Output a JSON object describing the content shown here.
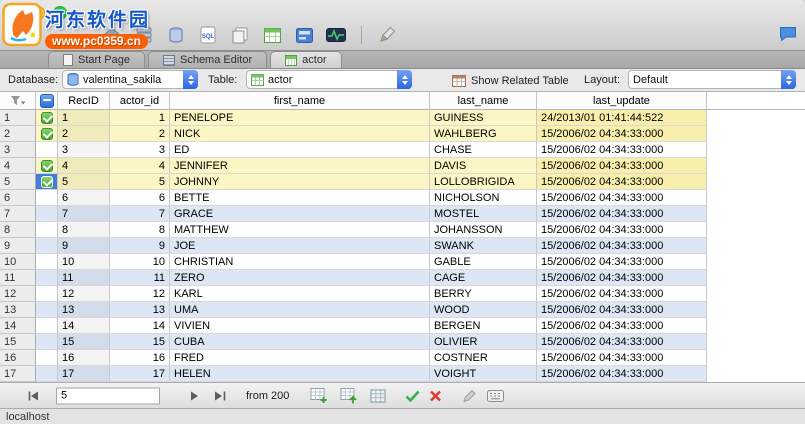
{
  "watermark": {
    "site_name": "河东软件园",
    "site_url": "www.pc0359.cn"
  },
  "toolbar": {
    "icons": [
      "home",
      "servers",
      "database",
      "sql-editor",
      "copy-document",
      "new-table",
      "form",
      "diagnose",
      "pencil",
      "feedback-chat"
    ]
  },
  "tabs": [
    {
      "label": "Start Page",
      "icon": "page",
      "active": false
    },
    {
      "label": "Schema Editor",
      "icon": "schema",
      "active": false
    },
    {
      "label": "actor",
      "icon": "table",
      "active": true
    }
  ],
  "controls": {
    "database_label": "Database:",
    "database_value": "valentina_sakila",
    "table_label": "Table:",
    "table_value": "actor",
    "show_related_label": "Show Related Table",
    "layout_label": "Layout:",
    "layout_value": "Default"
  },
  "grid": {
    "columns": [
      {
        "key": "recid",
        "label": "RecID"
      },
      {
        "key": "actor_id",
        "label": "actor_id"
      },
      {
        "key": "first_name",
        "label": "first_name"
      },
      {
        "key": "last_name",
        "label": "last_name"
      },
      {
        "key": "last_update",
        "label": "last_update"
      }
    ],
    "rows": [
      {
        "num": "1",
        "checked": true,
        "selected": false,
        "color": "yellow",
        "recid": "1",
        "actor_id": "1",
        "first_name": "PENELOPE",
        "last_name": "GUINESS",
        "last_update": "24/2013/01 01:41:44:522"
      },
      {
        "num": "2",
        "checked": true,
        "selected": false,
        "color": "yellow",
        "recid": "2",
        "actor_id": "2",
        "first_name": "NICK",
        "last_name": "WAHLBERG",
        "last_update": "15/2006/02 04:34:33:000"
      },
      {
        "num": "3",
        "checked": false,
        "selected": false,
        "color": "white",
        "recid": "3",
        "actor_id": "3",
        "first_name": "ED",
        "last_name": "CHASE",
        "last_update": "15/2006/02 04:34:33:000"
      },
      {
        "num": "4",
        "checked": true,
        "selected": false,
        "color": "yellow",
        "recid": "4",
        "actor_id": "4",
        "first_name": "JENNIFER",
        "last_name": "DAVIS",
        "last_update": "15/2006/02 04:34:33:000"
      },
      {
        "num": "5",
        "checked": true,
        "selected": true,
        "color": "yellow",
        "recid": "5",
        "actor_id": "5",
        "first_name": "JOHNNY",
        "last_name": "LOLLOBRIGIDA",
        "last_update": "15/2006/02 04:34:33:000"
      },
      {
        "num": "6",
        "checked": false,
        "selected": false,
        "color": "white",
        "recid": "6",
        "actor_id": "6",
        "first_name": "BETTE",
        "last_name": "NICHOLSON",
        "last_update": "15/2006/02 04:34:33:000"
      },
      {
        "num": "7",
        "checked": false,
        "selected": false,
        "color": "blue",
        "recid": "7",
        "actor_id": "7",
        "first_name": "GRACE",
        "last_name": "MOSTEL",
        "last_update": "15/2006/02 04:34:33:000"
      },
      {
        "num": "8",
        "checked": false,
        "selected": false,
        "color": "white",
        "recid": "8",
        "actor_id": "8",
        "first_name": "MATTHEW",
        "last_name": "JOHANSSON",
        "last_update": "15/2006/02 04:34:33:000"
      },
      {
        "num": "9",
        "checked": false,
        "selected": false,
        "color": "blue",
        "recid": "9",
        "actor_id": "9",
        "first_name": "JOE",
        "last_name": "SWANK",
        "last_update": "15/2006/02 04:34:33:000"
      },
      {
        "num": "10",
        "checked": false,
        "selected": false,
        "color": "white",
        "recid": "10",
        "actor_id": "10",
        "first_name": "CHRISTIAN",
        "last_name": "GABLE",
        "last_update": "15/2006/02 04:34:33:000"
      },
      {
        "num": "11",
        "checked": false,
        "selected": false,
        "color": "blue",
        "recid": "11",
        "actor_id": "11",
        "first_name": "ZERO",
        "last_name": "CAGE",
        "last_update": "15/2006/02 04:34:33:000"
      },
      {
        "num": "12",
        "checked": false,
        "selected": false,
        "color": "white",
        "recid": "12",
        "actor_id": "12",
        "first_name": "KARL",
        "last_name": "BERRY",
        "last_update": "15/2006/02 04:34:33:000"
      },
      {
        "num": "13",
        "checked": false,
        "selected": false,
        "color": "blue",
        "recid": "13",
        "actor_id": "13",
        "first_name": "UMA",
        "last_name": "WOOD",
        "last_update": "15/2006/02 04:34:33:000"
      },
      {
        "num": "14",
        "checked": false,
        "selected": false,
        "color": "white",
        "recid": "14",
        "actor_id": "14",
        "first_name": "VIVIEN",
        "last_name": "BERGEN",
        "last_update": "15/2006/02 04:34:33:000"
      },
      {
        "num": "15",
        "checked": false,
        "selected": false,
        "color": "blue",
        "recid": "15",
        "actor_id": "15",
        "first_name": "CUBA",
        "last_name": "OLIVIER",
        "last_update": "15/2006/02 04:34:33:000"
      },
      {
        "num": "16",
        "checked": false,
        "selected": false,
        "color": "white",
        "recid": "16",
        "actor_id": "16",
        "first_name": "FRED",
        "last_name": "COSTNER",
        "last_update": "15/2006/02 04:34:33:000"
      },
      {
        "num": "17",
        "checked": false,
        "selected": false,
        "color": "blue",
        "recid": "17",
        "actor_id": "17",
        "first_name": "HELEN",
        "last_name": "VOIGHT",
        "last_update": "15/2006/02 04:34:33:000"
      }
    ]
  },
  "pager": {
    "current_record": "5",
    "total_label": "from 200"
  },
  "status_bar": {
    "text": "localhost"
  }
}
